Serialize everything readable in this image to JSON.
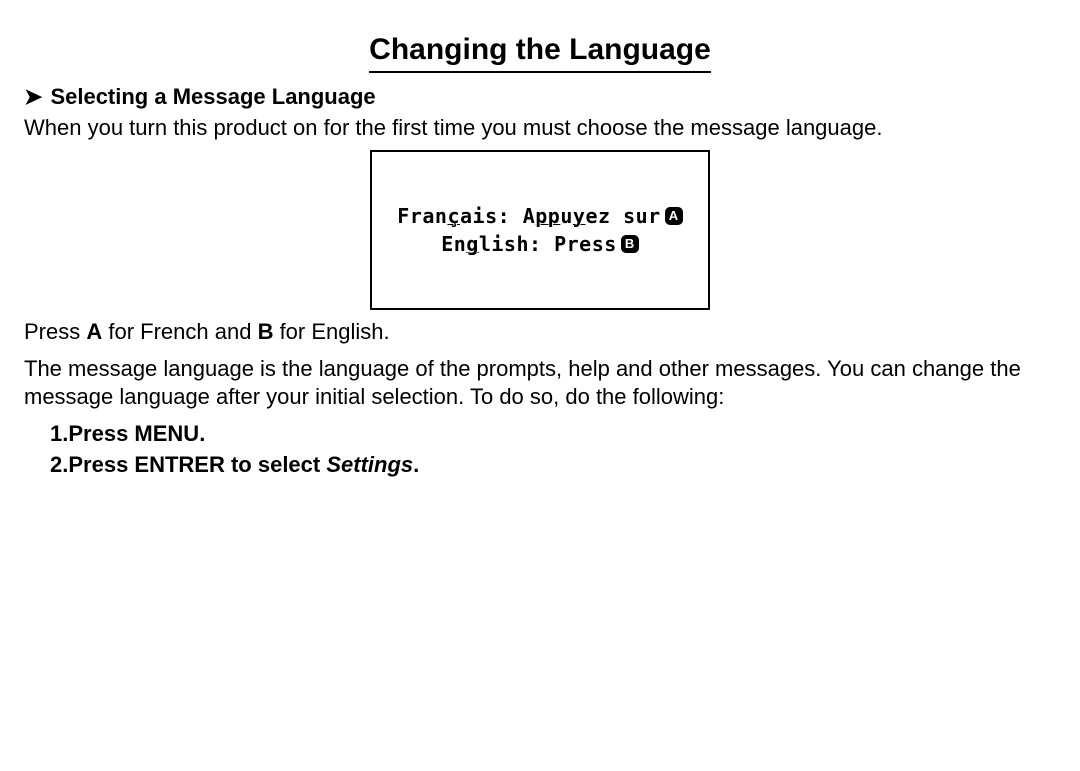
{
  "title": "Changing the Language",
  "section": {
    "arrow": "➤",
    "heading": "Selecting a Message Language",
    "intro": "When you turn this product on for the first time you must choose the message language."
  },
  "lcd": {
    "line1_a": "Fran",
    "line1_b": "ç",
    "line1_c": "ais: A",
    "line1_d": "pp",
    "line1_e": "u",
    "line1_f": "y",
    "line1_g": "ez sur",
    "key1": "A",
    "line2_a": "En",
    "line2_b": "g",
    "line2_c": "lish: Press",
    "key2": "B"
  },
  "press_instruction": {
    "pre1": "Press ",
    "bold1": "A",
    "mid": " for French and ",
    "bold2": "B",
    "post": " for English."
  },
  "explanation": "The message language is the language of the prompts, help and other messages. You can change the message language after your initial selection. To do so, do the following:",
  "steps": {
    "s1_pre": "1.",
    "s1": "Press MENU.",
    "s2_pre": "2.",
    "s2a": "Press ENTRER to select ",
    "s2b": "Settings",
    "s2c": "."
  }
}
